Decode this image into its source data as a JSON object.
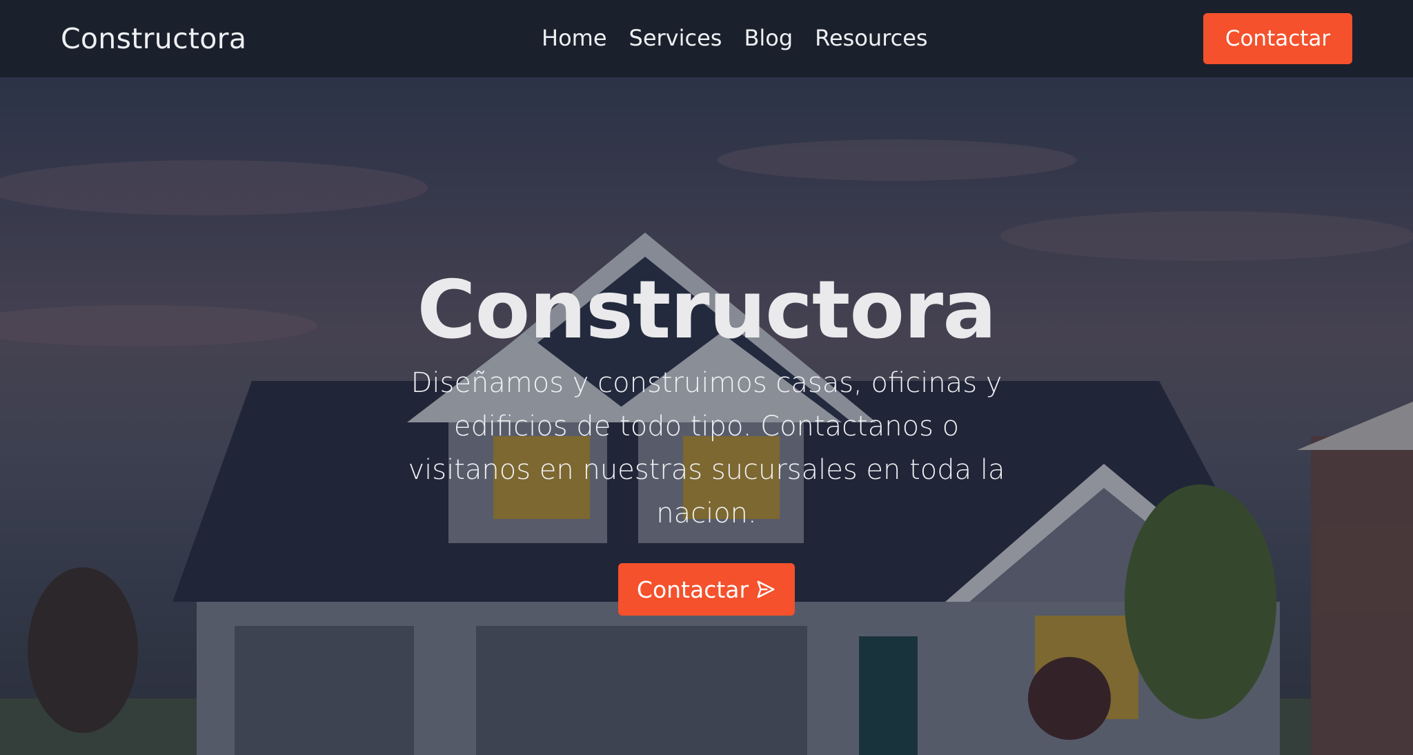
{
  "navbar": {
    "brand": "Constructora",
    "links": [
      {
        "label": "Home"
      },
      {
        "label": "Services"
      },
      {
        "label": "Blog"
      },
      {
        "label": "Resources"
      }
    ],
    "cta_label": "Contactar"
  },
  "hero": {
    "title": "Constructora",
    "text": "Diseñamos y construimos casas, oficinas y edificios de todo tipo. Contactanos o visitanos en nuestras sucursales en toda la nacion.",
    "cta_label": "Contactar",
    "cta_icon": "send-icon"
  },
  "colors": {
    "navbar_bg": "#1b212c",
    "accent": "#f4512c",
    "text": "#eef0f3"
  }
}
